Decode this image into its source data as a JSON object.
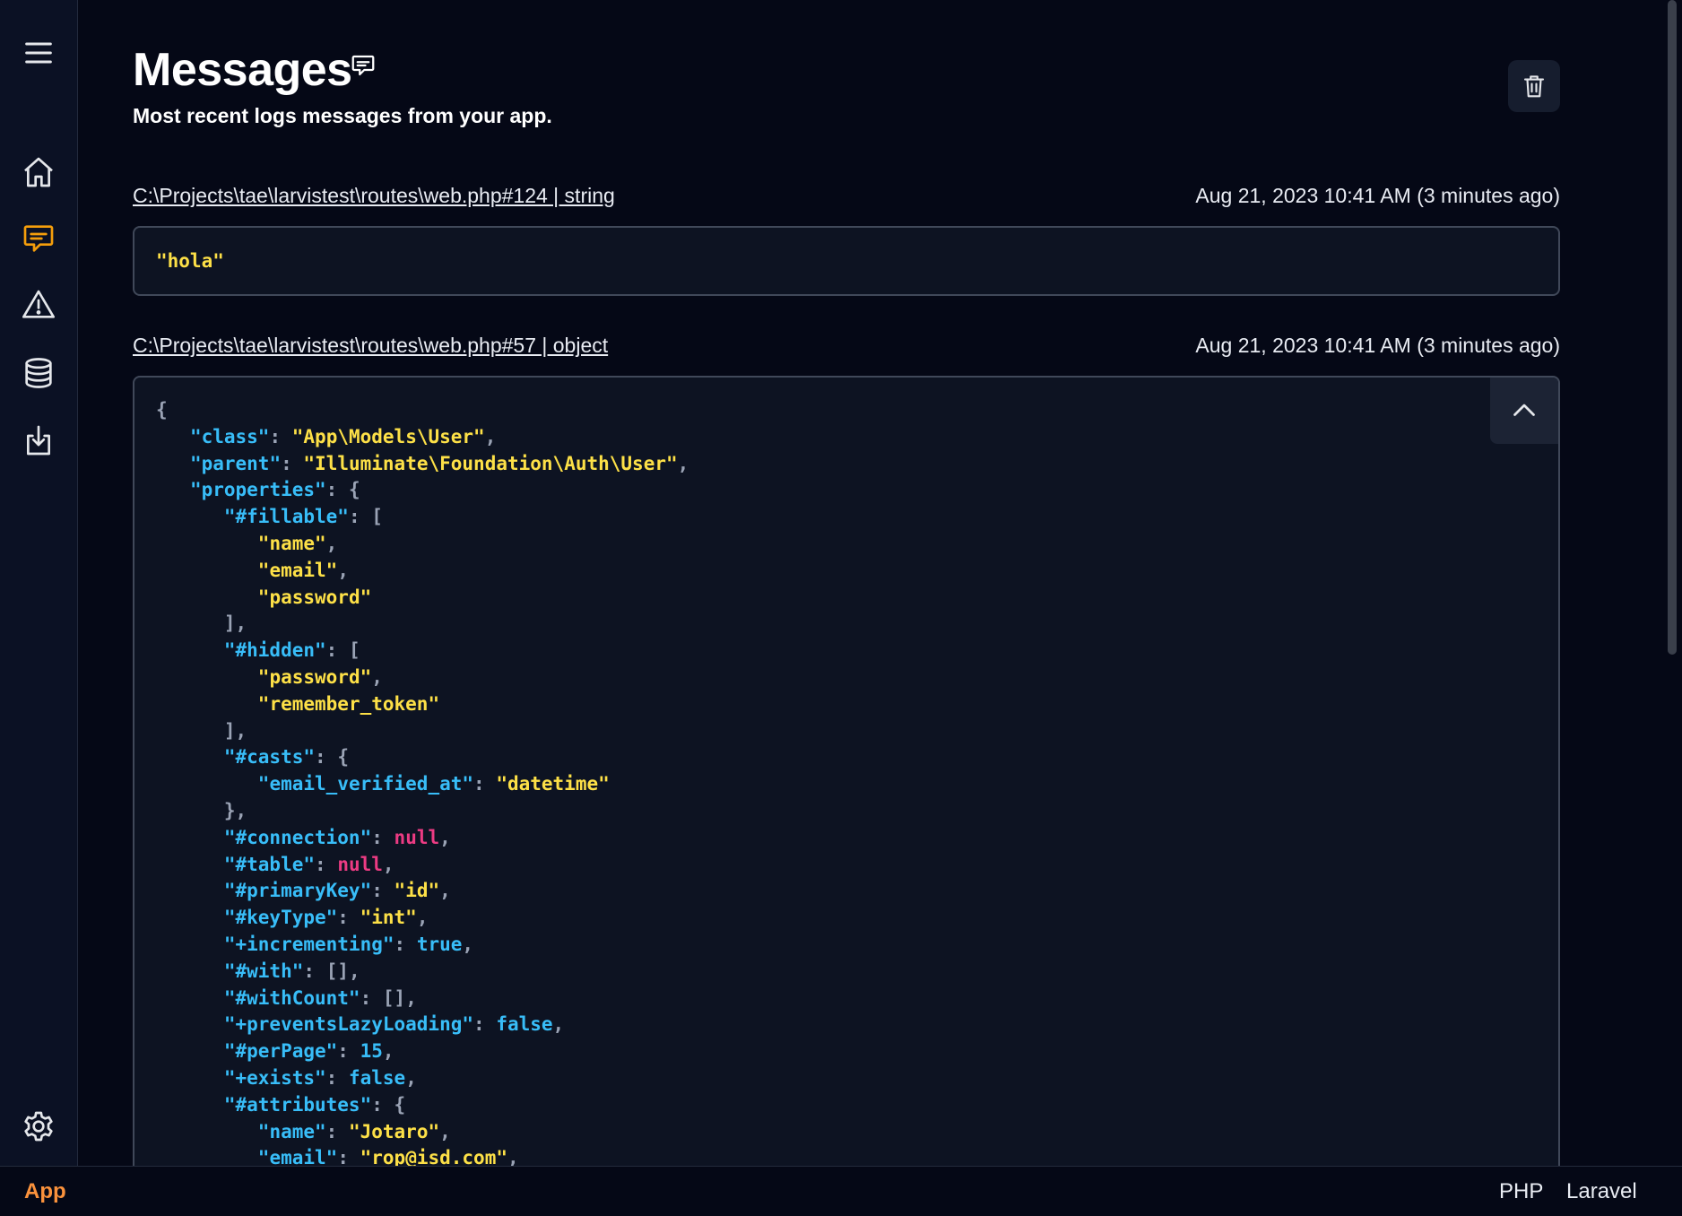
{
  "page": {
    "title": "Messages",
    "subtitle": "Most recent logs messages from your app."
  },
  "sidebar": {
    "items": [
      {
        "icon": "menu-icon"
      },
      {
        "icon": "home-icon"
      },
      {
        "icon": "messages-icon",
        "active": true
      },
      {
        "icon": "warning-icon"
      },
      {
        "icon": "database-icon"
      },
      {
        "icon": "download-icon"
      },
      {
        "icon": "settings-icon"
      }
    ]
  },
  "colors": {
    "accent": "#f59e0b",
    "key": "#38bdf8",
    "string": "#fde047",
    "null": "#ec3b83",
    "status_app": "#fb923c"
  },
  "messages": [
    {
      "source": "C:\\Projects\\tae\\larvistest\\routes\\web.php#124 | string",
      "timestamp": "Aug 21, 2023 10:41 AM (3 minutes ago)",
      "content": "\"hola\""
    },
    {
      "source": "C:\\Projects\\tae\\larvistest\\routes\\web.php#57 | object",
      "timestamp": "Aug 21, 2023 10:41 AM (3 minutes ago)",
      "lines": [
        "{",
        "   \"class\": \"App\\Models\\User\",",
        "   \"parent\": \"Illuminate\\Foundation\\Auth\\User\",",
        "   \"properties\": {",
        "      \"#fillable\": [",
        "         \"name\",",
        "         \"email\",",
        "         \"password\"",
        "      ],",
        "      \"#hidden\": [",
        "         \"password\",",
        "         \"remember_token\"",
        "      ],",
        "      \"#casts\": {",
        "         \"email_verified_at\": \"datetime\"",
        "      },",
        "      \"#connection\": null,",
        "      \"#table\": null,",
        "      \"#primaryKey\": \"id\",",
        "      \"#keyType\": \"int\",",
        "      \"+incrementing\": true,",
        "      \"#with\": [],",
        "      \"#withCount\": [],",
        "      \"+preventsLazyLoading\": false,",
        "      \"#perPage\": 15,",
        "      \"+exists\": false,",
        "      \"#attributes\": {",
        "         \"name\": \"Jotaro\",",
        "         \"email\": \"rop@isd.com\","
      ]
    }
  ],
  "statusbar": {
    "app": "App",
    "php": "PHP",
    "laravel": "Laravel"
  }
}
